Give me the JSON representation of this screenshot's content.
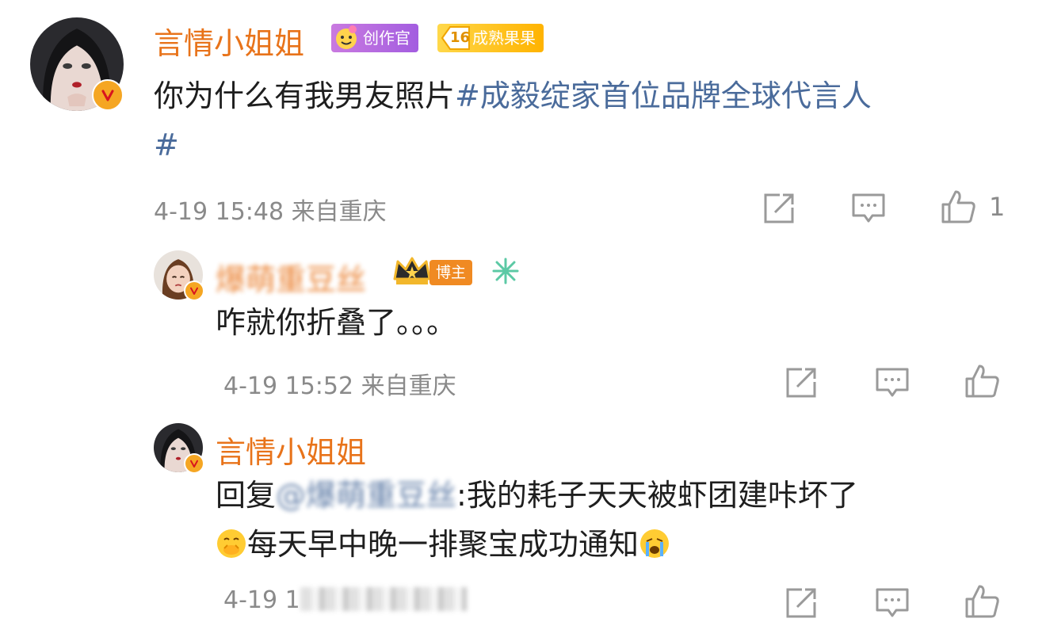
{
  "comments": [
    {
      "username": "言情小姐姐",
      "badges": {
        "creator": "创作官",
        "fan_level": "16",
        "fan_label": "成熟果果"
      },
      "text": "你为什么有我男友照片",
      "topic_line1": "#成毅绽家首位品牌全球代言人",
      "topic_line2": "#",
      "time": "4-19 15:48 来自重庆",
      "like_count": "1"
    },
    {
      "username": "爆萌重豆丝",
      "badges": {
        "host": "博主"
      },
      "text": "咋就你折叠了。。。",
      "time": "4-19 15:52 来自重庆"
    },
    {
      "username": "言情小姐姐",
      "reply_prefix": "回复",
      "mention": "@爆萌重豆丝",
      "text_line1": ":我的耗子天天被虾团建咔坏了",
      "text_line2": "每天早中晚一排聚宝成功通知",
      "time_visible": "4-19 1",
      "emoji1": "cover-mouth-face",
      "emoji2": "loudly-crying-face"
    }
  ],
  "icons": {
    "share": "share-icon",
    "comment": "comment-icon",
    "like": "like-icon",
    "verified": "verified-badge-icon"
  },
  "colors": {
    "username": "#e8731a",
    "topic": "#4a6b9b",
    "meta": "#8a8a8a",
    "verified": "#f5a623"
  }
}
